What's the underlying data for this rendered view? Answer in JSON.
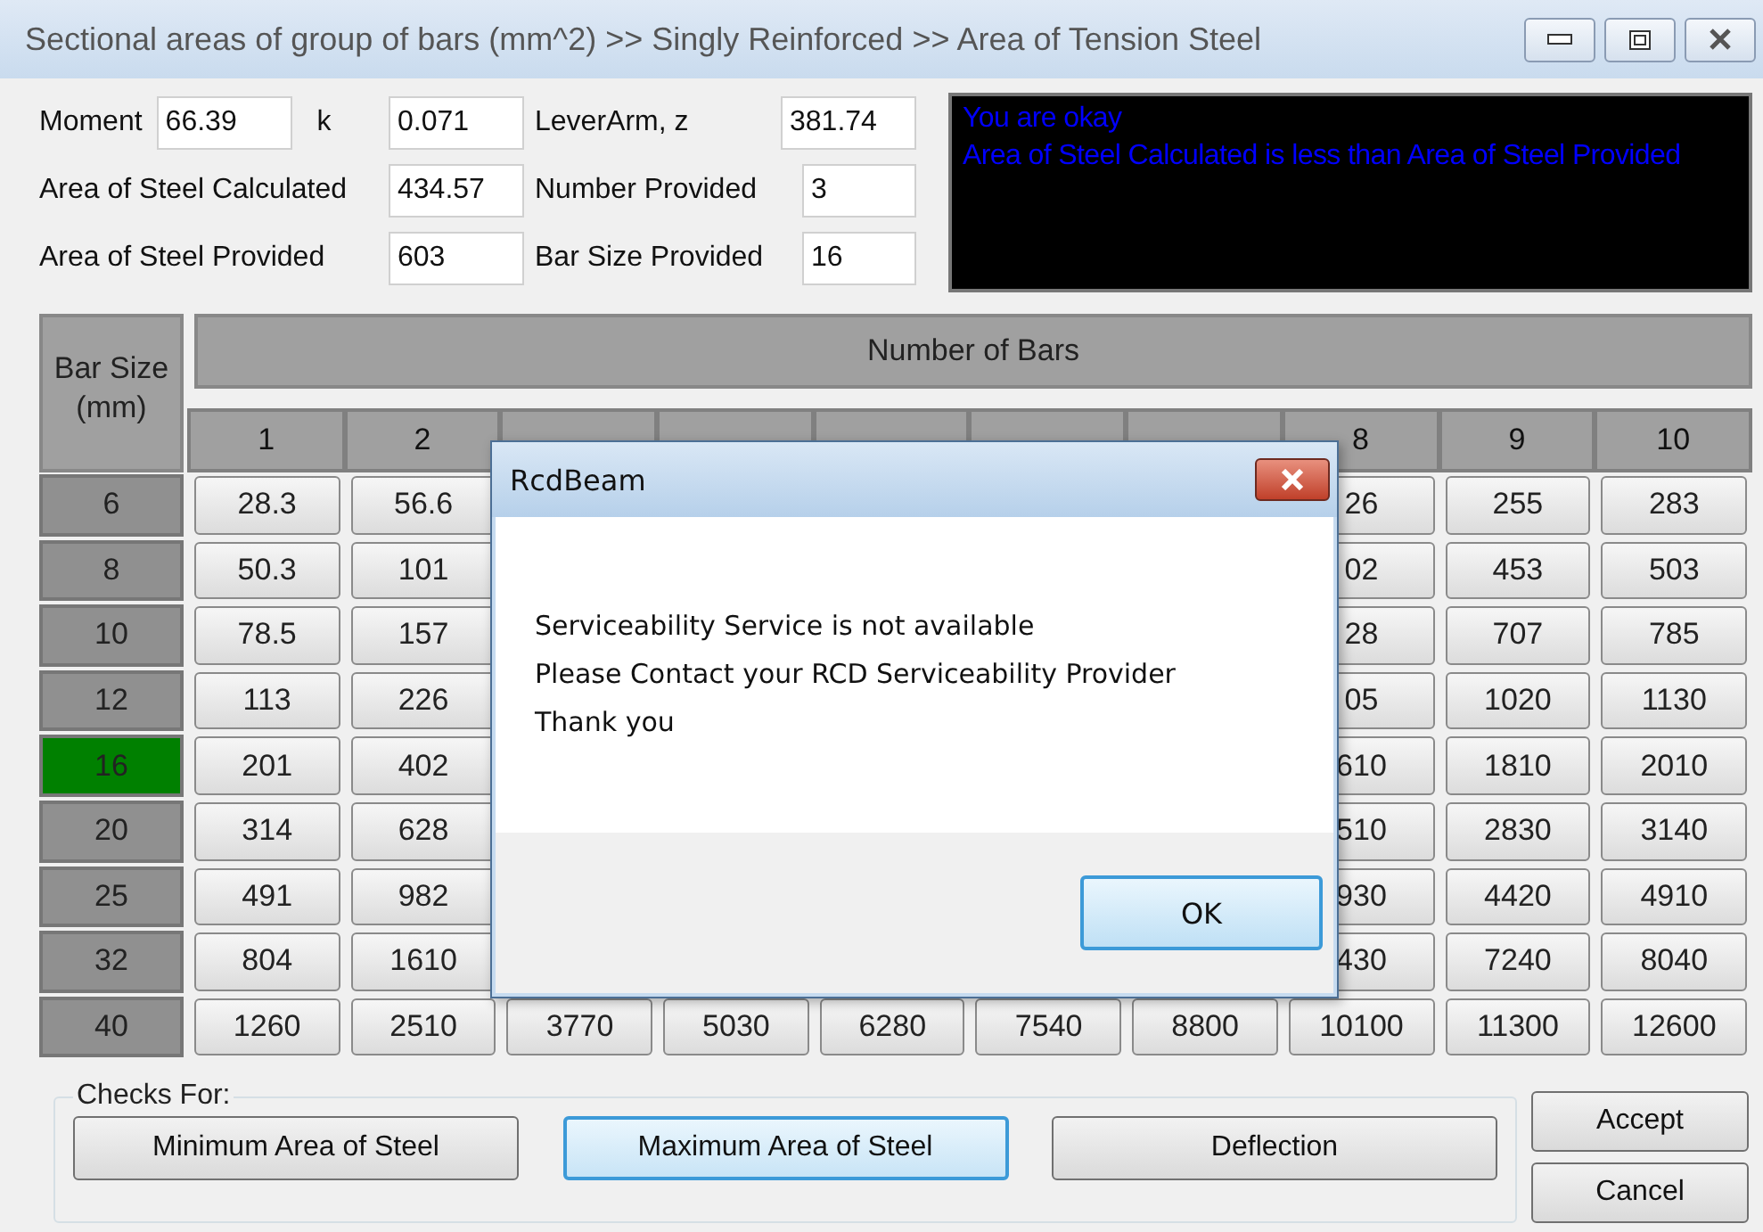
{
  "window": {
    "title": "Sectional areas of group of bars (mm^2) >> Singly Reinforced >> Area of Tension Steel"
  },
  "form": {
    "moment_label": "Moment",
    "moment": "66.39",
    "k_label": "k",
    "k": "0.071",
    "lever_arm_label": "LeverArm, z",
    "lever_arm": "381.74",
    "steel_calculated_label": "Area of Steel Calculated",
    "steel_calculated": "434.57",
    "number_provided_label": "Number Provided",
    "number_provided": "3",
    "steel_provided_label": "Area of Steel Provided",
    "steel_provided": "603",
    "bar_size_provided_label": "Bar Size Provided",
    "bar_size_provided": "16"
  },
  "message_box": {
    "lines": [
      "You are okay",
      "Area of Steel Calculated is less than Area of Steel Provided"
    ]
  },
  "table": {
    "row_header": [
      "Bar Size",
      "(mm)"
    ],
    "column_group_header": "Number of Bars",
    "columns": [
      "1",
      "2",
      "8",
      "9",
      "10"
    ],
    "rows": [
      {
        "size": "6",
        "selected": false,
        "cells": [
          "28.3",
          "56.6",
          "26",
          "255",
          "283"
        ]
      },
      {
        "size": "8",
        "selected": false,
        "cells": [
          "50.3",
          "101",
          "02",
          "453",
          "503"
        ]
      },
      {
        "size": "10",
        "selected": false,
        "cells": [
          "78.5",
          "157",
          "28",
          "707",
          "785"
        ]
      },
      {
        "size": "12",
        "selected": false,
        "cells": [
          "113",
          "226",
          "05",
          "1020",
          "1130"
        ]
      },
      {
        "size": "16",
        "selected": true,
        "cells": [
          "201",
          "402",
          "610",
          "1810",
          "2010"
        ]
      },
      {
        "size": "20",
        "selected": false,
        "cells": [
          "314",
          "628",
          "510",
          "2830",
          "3140"
        ]
      },
      {
        "size": "25",
        "selected": false,
        "cells": [
          "491",
          "982",
          "930",
          "4420",
          "4910"
        ]
      },
      {
        "size": "32",
        "selected": false,
        "cells": [
          "804",
          "1610",
          "430",
          "7240",
          "8040"
        ]
      },
      {
        "size": "40",
        "selected": false,
        "cells": [
          "1260",
          "2510",
          "3770",
          "5030",
          "6280",
          "7540",
          "8800",
          "10100",
          "11300",
          "12600"
        ]
      }
    ]
  },
  "dialog": {
    "title": "RcdBeam",
    "lines": [
      "Serviceability Service is not available",
      "Please Contact your RCD Serviceability Provider",
      "Thank you"
    ],
    "button": "OK"
  },
  "checks": {
    "legend": "Checks For:",
    "buttons": [
      {
        "label": "Minimum Area of Steel",
        "focused": false
      },
      {
        "label": "Maximum Area of Steel",
        "focused": true
      },
      {
        "label": "Deflection",
        "focused": false
      }
    ]
  },
  "actions": [
    "Accept",
    "Cancel"
  ]
}
